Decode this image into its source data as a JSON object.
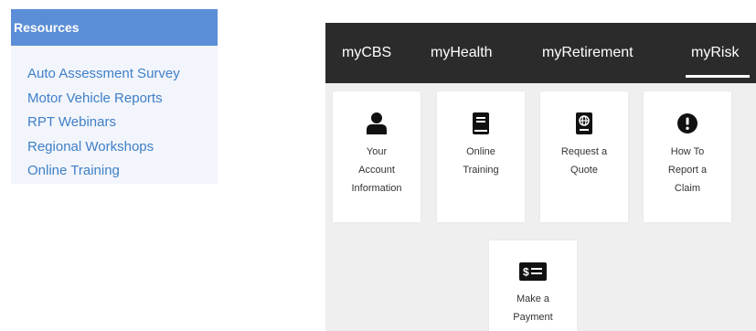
{
  "resources": {
    "title": "Resources",
    "links": [
      "Auto Assessment Survey",
      "Motor Vehicle Reports",
      "RPT Webinars",
      "Regional Workshops",
      "Online Training"
    ]
  },
  "portal": {
    "nav": {
      "tabs": [
        "myCBS",
        "myHealth",
        "myRetirement",
        "myRisk"
      ],
      "active": "myRisk"
    },
    "tiles": [
      {
        "label": "Your\nAccount\nInformation",
        "icon": "user-icon"
      },
      {
        "label": "Online\nTraining",
        "icon": "book-icon"
      },
      {
        "label": "Request a\nQuote",
        "icon": "passport-icon"
      },
      {
        "label": "How To\nReport a\nClaim",
        "icon": "exclamation-circle-icon"
      },
      {
        "label": "Make a\nPayment",
        "icon": "money-check-icon"
      }
    ]
  },
  "colors": {
    "resources_header": "#5b8ed6",
    "resources_bg": "#f2f5fb",
    "link": "#3f7fc8",
    "nav_bg": "#2b2b2b",
    "portal_bg": "#efefef"
  }
}
